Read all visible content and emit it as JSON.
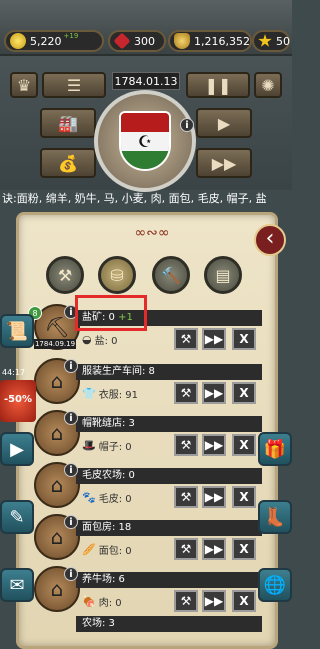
{
  "resources": {
    "coins": "5,220",
    "coins_delta": "+19",
    "gems": "300",
    "money": "1,216,352",
    "stars": "50"
  },
  "hud": {
    "date": "1784.01.13",
    "menu_icon": "menu-icon",
    "pause_icon": "pause-icon",
    "play_icon": "play-icon",
    "fast_forward_icon": "fast-forward-icon"
  },
  "demand_text": "诀:面粉, 绵羊, 奶牛, 马, 小麦, 肉, 面包, 毛皮, 帽子, 盐",
  "sale": {
    "timer": "44:17",
    "label": "-50%"
  },
  "buildings": [
    {
      "name": "盐矿: 0",
      "delta": " +1",
      "product_icon": "salt-icon",
      "product": "盐: 0",
      "level": "8",
      "date": "1784.09.19"
    },
    {
      "name": "服装生产车间: 8",
      "delta": "",
      "product_icon": "clothes-icon",
      "product": "衣服: 91"
    },
    {
      "name": "帽靴缝店: 3",
      "delta": "",
      "product_icon": "hat-icon",
      "product": "帽子: 0"
    },
    {
      "name": "毛皮农场: 0",
      "delta": "",
      "product_icon": "fur-icon",
      "product": "毛皮: 0"
    },
    {
      "name": "面包房: 18",
      "delta": "",
      "product_icon": "bread-icon",
      "product": "面包: 0"
    },
    {
      "name": "养牛场: 6",
      "delta": "",
      "product_icon": "meat-icon",
      "product": "肉: 0"
    },
    {
      "name": "农场: 3",
      "delta": "",
      "product_icon": "",
      "product": ""
    }
  ],
  "colors": {
    "accent_green": "#7ec84a",
    "highlight_red": "#e52a2a",
    "parchment": "#e8dcbc"
  }
}
